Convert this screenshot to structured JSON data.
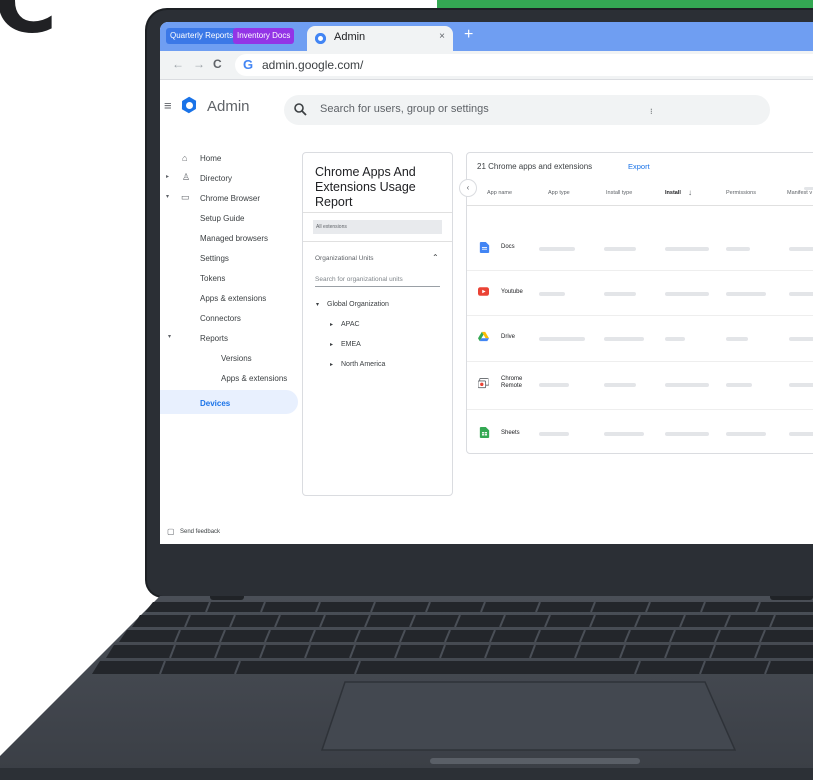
{
  "background": {
    "brand_letter": "C",
    "accent_green": "#34a853"
  },
  "browser": {
    "mini_tabs": [
      "Quarterly Reports",
      "Inventory Docs"
    ],
    "active_tab": {
      "title": "Admin",
      "close": "×"
    },
    "new_tab": "+",
    "nav": {
      "back": "←",
      "forward": "→",
      "reload": "C"
    },
    "omnibox": {
      "logo": "G",
      "url": "admin.google.com/"
    },
    "colors": {
      "tabbar": "#6f9ef2",
      "tab_blue": "#3b78e7",
      "tab_purple": "#9334e6"
    }
  },
  "header": {
    "menu_icon": "≡",
    "app_title": "Admin",
    "search_icon": "⚲",
    "search_placeholder": "Search for users, group or settings"
  },
  "sidebar": {
    "items": [
      {
        "label": "Home",
        "icon": "home-icon"
      },
      {
        "label": "Directory",
        "icon": "person-icon"
      },
      {
        "label": "Chrome Browser",
        "icon": "devices-icon"
      },
      {
        "label": "Setup Guide"
      },
      {
        "label": "Managed browsers"
      },
      {
        "label": "Settings"
      },
      {
        "label": "Tokens"
      },
      {
        "label": "Apps & extensions"
      },
      {
        "label": "Connectors"
      },
      {
        "label": "Reports"
      },
      {
        "label": "Versions"
      },
      {
        "label": "Apps & extensions"
      },
      {
        "label": "Devices"
      }
    ],
    "feedback": "Send feedback",
    "active_color": "#1a73e8"
  },
  "report": {
    "title": "Chrome Apps And Extensions Usage Report",
    "filter": "All extensions",
    "ou_label": "Organizational Units",
    "ou_search": "Search for organizational units",
    "tree": [
      "Global Organization",
      "APAC",
      "EMEA",
      "North America"
    ]
  },
  "table": {
    "count": "21 Chrome apps and extensions",
    "export": "Export",
    "headers": [
      "App name",
      "App type",
      "Install type",
      "Install",
      "Permissions",
      "Manifest v"
    ],
    "sort_icon": "↓",
    "rows": [
      {
        "name": "Docs",
        "icon": "docs-icon",
        "color": "#4285f4"
      },
      {
        "name": "Youtube",
        "icon": "youtube-icon",
        "color": "#ea4335"
      },
      {
        "name": "Drive",
        "icon": "drive-icon",
        "color": "#fbbc04"
      },
      {
        "name": "Chrome Remote",
        "icon": "chrome-remote-icon",
        "color": "#5f6368"
      },
      {
        "name": "Sheets",
        "icon": "sheets-icon",
        "color": "#34a853"
      }
    ]
  }
}
